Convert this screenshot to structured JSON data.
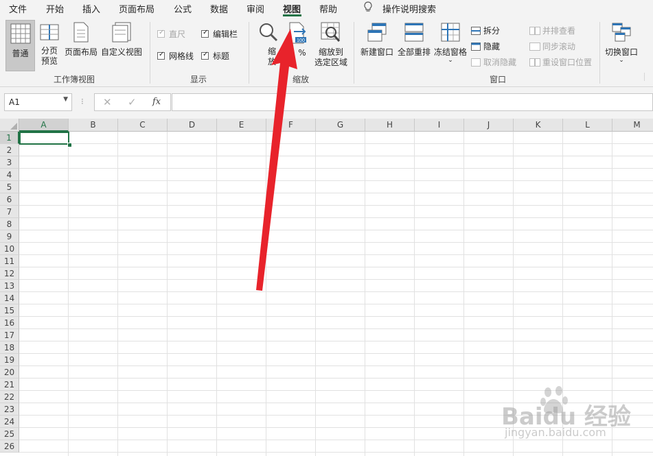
{
  "menu": {
    "tabs": [
      "文件",
      "开始",
      "插入",
      "页面布局",
      "公式",
      "数据",
      "审阅",
      "视图",
      "帮助"
    ],
    "active_tab": "视图",
    "tell_me": "操作说明搜索"
  },
  "ribbon": {
    "workbook_views": {
      "group_label": "工作簿视图",
      "normal": "普通",
      "page_break_preview": [
        "分页",
        "预览"
      ],
      "page_layout": "页面布局",
      "custom_views": "自定义视图"
    },
    "show": {
      "group_label": "显示",
      "ruler": "直尺",
      "formula_bar": "编辑栏",
      "gridlines": "网格线",
      "headings": "标题"
    },
    "zoom": {
      "group_label": "缩放",
      "zoom_partial": [
        "缩",
        "放"
      ],
      "hundred_partial": "%",
      "zoom_to_selection": [
        "缩放到",
        "选定区域"
      ]
    },
    "window": {
      "group_label": "窗口",
      "new_window": "新建窗口",
      "arrange_all": "全部重排",
      "freeze_panes": "冻结窗格",
      "split": "拆分",
      "hide": "隐藏",
      "unhide": "取消隐藏",
      "view_side_by_side": "并排查看",
      "sync_scroll": "同步滚动",
      "reset_position": "重设窗口位置",
      "switch_windows": "切换窗口"
    }
  },
  "formula_bar": {
    "name_box": "A1",
    "fx": "fx",
    "value": ""
  },
  "sheet": {
    "columns": [
      "A",
      "B",
      "C",
      "D",
      "E",
      "F",
      "G",
      "H",
      "I",
      "J",
      "K",
      "L",
      "M"
    ],
    "rows": [
      "1",
      "2",
      "3",
      "4",
      "5",
      "6",
      "7",
      "8",
      "9",
      "10",
      "11",
      "12",
      "13",
      "14",
      "15",
      "16",
      "17",
      "18",
      "19",
      "20",
      "21",
      "22",
      "23",
      "24",
      "25",
      "26"
    ],
    "active_cell": "A1"
  },
  "watermark": {
    "brand": "Baidu 经验",
    "url": "jingyan.baidu.com"
  },
  "colors": {
    "accent": "#217346",
    "arrow": "#e8232b"
  },
  "overlay_arrow": "red arrow pointing to 100% zoom button"
}
